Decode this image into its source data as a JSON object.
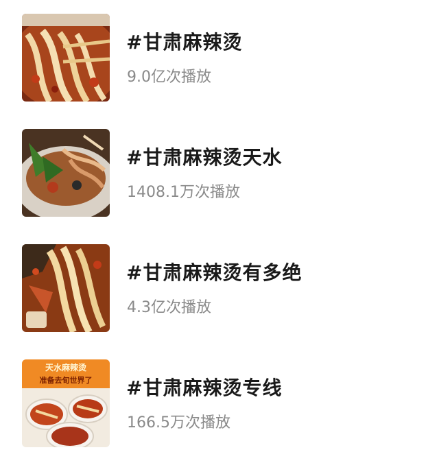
{
  "topics": [
    {
      "title": "#甘肃麻辣烫",
      "plays": "9.0亿次播放"
    },
    {
      "title": "#甘肃麻辣烫天水",
      "plays": "1408.1万次播放"
    },
    {
      "title": "#甘肃麻辣烫有多绝",
      "plays": "4.3亿次播放"
    },
    {
      "title": "#甘肃麻辣烫专线",
      "plays": "166.5万次播放",
      "thumb_text": [
        "天水麻辣烫",
        "准备去旬世界了"
      ]
    }
  ],
  "colors": {
    "title": "#1a1a1a",
    "plays": "#8a8a8a",
    "banner_orange": "#f08a24"
  }
}
